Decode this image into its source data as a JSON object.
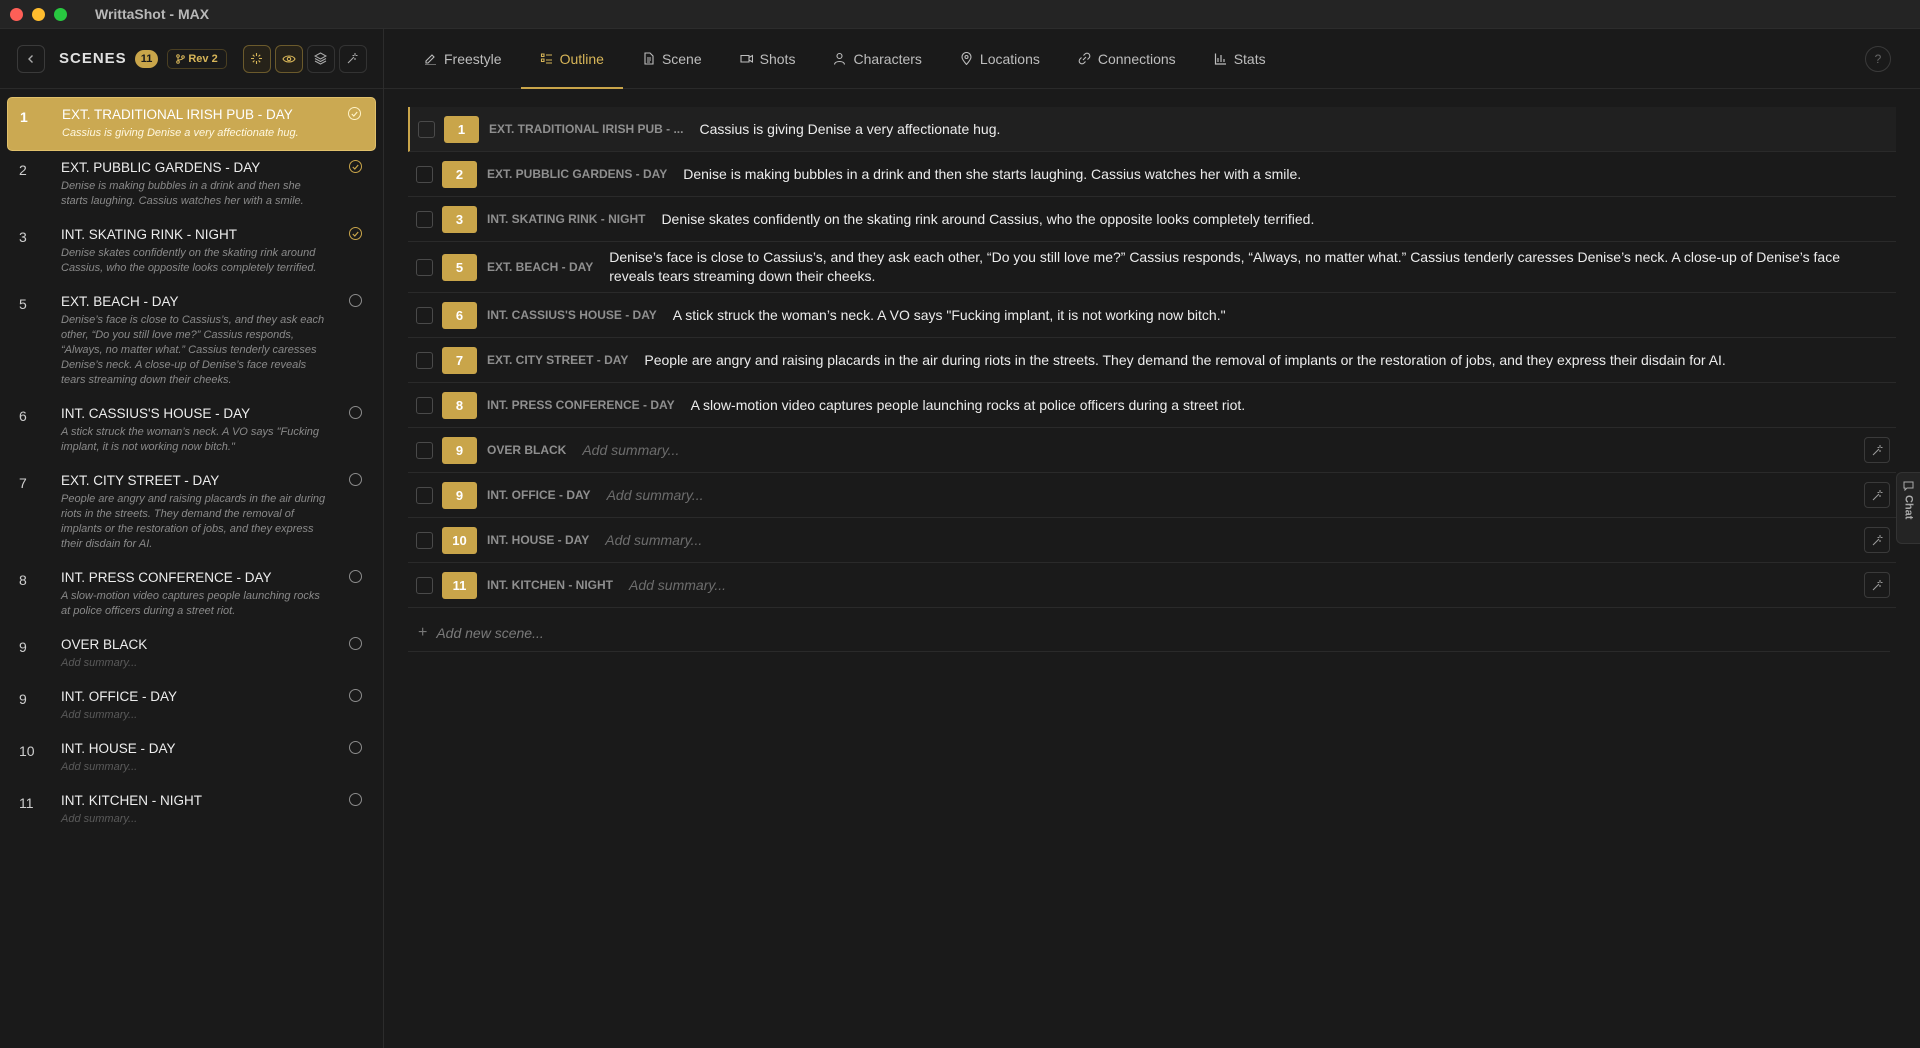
{
  "window": {
    "title": "WrittaShot - MAX"
  },
  "sidebar": {
    "title": "SCENES",
    "count": "11",
    "revision": "Rev 2",
    "scenes": [
      {
        "num": "1",
        "heading": "EXT. TRADITIONAL IRISH PUB - DAY",
        "summary": "Cassius is giving Denise a very affectionate hug.",
        "status": "done"
      },
      {
        "num": "2",
        "heading": "EXT. PUBBLIC GARDENS - DAY",
        "summary": "Denise is making bubbles in a drink and then she starts laughing. Cassius watches her with a smile.",
        "status": "done"
      },
      {
        "num": "3",
        "heading": "INT. SKATING RINK - NIGHT",
        "summary": "Denise skates confidently on the skating rink around Cassius, who the opposite looks completely terrified.",
        "status": "done"
      },
      {
        "num": "5",
        "heading": "EXT. BEACH - DAY",
        "summary": "Denise’s face is close to Cassius’s, and they ask each other, “Do you still love me?” Cassius responds, “Always, no matter what.” Cassius tenderly caresses Denise’s neck. A close-up of Denise’s face reveals tears streaming down their cheeks.",
        "status": "open"
      },
      {
        "num": "6",
        "heading": "INT. CASSIUS'S HOUSE - DAY",
        "summary": "A stick struck the woman’s neck. A VO says \"Fucking implant, it is not working now bitch.\"",
        "status": "open"
      },
      {
        "num": "7",
        "heading": "EXT. CITY STREET - DAY",
        "summary": "People are angry and raising placards in the air during riots in the streets. They demand the removal of implants or the restoration of jobs, and they express their disdain for AI.",
        "status": "open"
      },
      {
        "num": "8",
        "heading": "INT. PRESS CONFERENCE - DAY",
        "summary": "A slow-motion video captures people launching rocks at police officers during a street riot.",
        "status": "open"
      },
      {
        "num": "9",
        "heading": "OVER BLACK",
        "summary": "Add summary...",
        "status": "open",
        "empty": true
      },
      {
        "num": "9",
        "heading": "INT. OFFICE - DAY",
        "summary": "Add summary...",
        "status": "open",
        "empty": true
      },
      {
        "num": "10",
        "heading": "INT. HOUSE - DAY",
        "summary": "Add summary...",
        "status": "open",
        "empty": true
      },
      {
        "num": "11",
        "heading": "INT. KITCHEN - NIGHT",
        "summary": "Add summary...",
        "status": "open",
        "empty": true
      }
    ]
  },
  "tabs": [
    {
      "label": "Freestyle",
      "icon": "edit-icon"
    },
    {
      "label": "Outline",
      "icon": "list-icon",
      "active": true
    },
    {
      "label": "Scene",
      "icon": "document-icon"
    },
    {
      "label": "Shots",
      "icon": "camera-icon"
    },
    {
      "label": "Characters",
      "icon": "user-icon"
    },
    {
      "label": "Locations",
      "icon": "pin-icon"
    },
    {
      "label": "Connections",
      "icon": "link-icon"
    },
    {
      "label": "Stats",
      "icon": "bar-chart-icon"
    }
  ],
  "outline": {
    "rows": [
      {
        "num": "1",
        "heading": "EXT. TRADITIONAL IRISH PUB - ...",
        "summary": "Cassius is giving Denise a very affectionate hug."
      },
      {
        "num": "2",
        "heading": "EXT. PUBBLIC GARDENS - DAY",
        "summary": "Denise is making bubbles in a drink and then she starts laughing. Cassius watches her with a smile."
      },
      {
        "num": "3",
        "heading": "INT. SKATING RINK - NIGHT",
        "summary": "Denise skates confidently on the skating rink around Cassius, who the opposite looks completely terrified."
      },
      {
        "num": "5",
        "heading": "EXT. BEACH - DAY",
        "summary": "Denise’s face is close to Cassius’s, and they ask each other, “Do you still love me?” Cassius responds, “Always, no matter what.” Cassius tenderly caresses Denise’s neck. A close-up of Denise’s face reveals tears streaming down their cheeks."
      },
      {
        "num": "6",
        "heading": "INT. CASSIUS'S HOUSE - DAY",
        "summary": "A stick struck the woman’s neck. A VO says \"Fucking implant, it is not working now bitch.\""
      },
      {
        "num": "7",
        "heading": "EXT. CITY STREET - DAY",
        "summary": "People are angry and raising placards in the air during riots in the streets. They demand the removal of implants or the restoration of jobs, and they express their disdain for AI."
      },
      {
        "num": "8",
        "heading": "INT. PRESS CONFERENCE - DAY",
        "summary": "A slow-motion video captures people launching rocks at police officers during a street riot."
      },
      {
        "num": "9",
        "heading": "OVER BLACK",
        "summary": "Add summary...",
        "empty": true
      },
      {
        "num": "9",
        "heading": "INT. OFFICE - DAY",
        "summary": "Add summary...",
        "empty": true
      },
      {
        "num": "10",
        "heading": "INT. HOUSE - DAY",
        "summary": "Add summary...",
        "empty": true
      },
      {
        "num": "11",
        "heading": "INT. KITCHEN - NIGHT",
        "summary": "Add summary...",
        "empty": true
      }
    ],
    "add_label": "Add new scene..."
  },
  "chat": {
    "label": "Chat"
  },
  "help": {
    "label": "?"
  },
  "colors": {
    "accent": "#c9a54a",
    "background": "#1a1a1a"
  }
}
